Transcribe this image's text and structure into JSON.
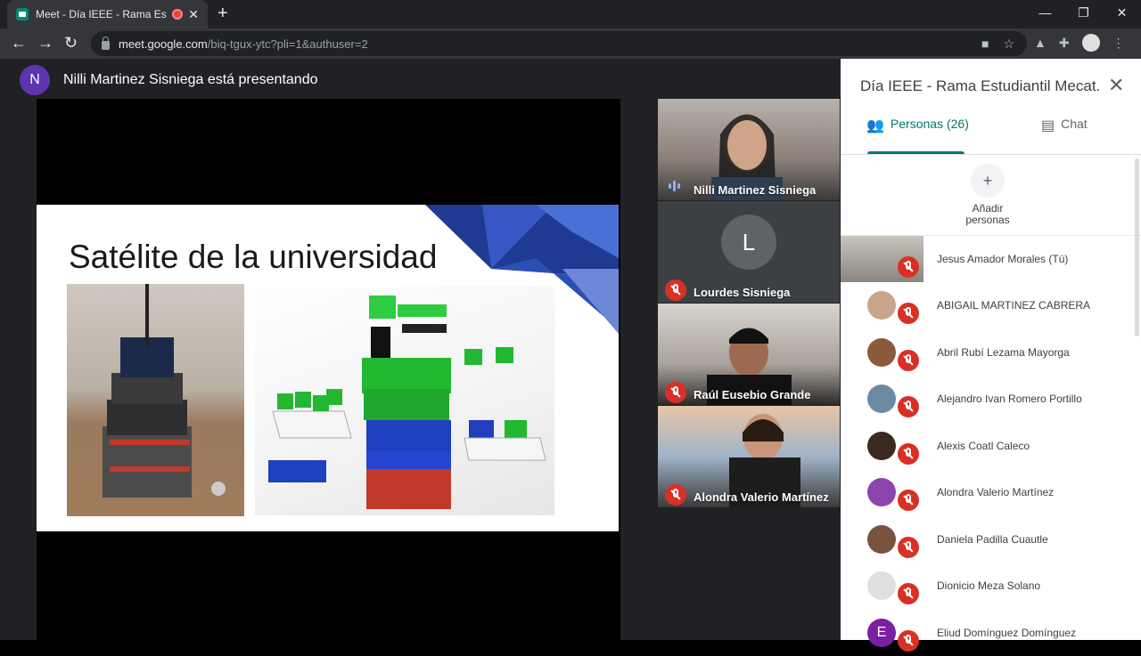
{
  "browser": {
    "tab_title": "Meet - Día IEEE - Rama Estud",
    "url_domain": "meet.google.com",
    "url_path": "/biq-tgux-ytc?pli=1&authuser=2"
  },
  "meet": {
    "presenter_initial": "N",
    "presenting_text": "Nilli Martinez Sisniega está presentando",
    "slide": {
      "title": "Satélite de la universidad"
    }
  },
  "tiles": [
    {
      "name": "Nilli Martinez Sisniega",
      "status": "speaking"
    },
    {
      "name": "Lourdes Sisniega",
      "initial": "L",
      "status": "muted"
    },
    {
      "name": "Raúl Eusebio Grande",
      "status": "muted"
    },
    {
      "name": "Alondra Valerio Martínez",
      "status": "muted"
    }
  ],
  "panel": {
    "title": "Día IEEE - Rama Estudiantil Mecat...",
    "tab_people": "Personas (26)",
    "tab_chat": "Chat",
    "add_people": "Añadir personas",
    "participants": [
      {
        "name": "Jesus Amador Morales (Tú)"
      },
      {
        "name": "ABIGAIL MARTINEZ CABRERA"
      },
      {
        "name": "Abril Rubí Lezama Mayorga"
      },
      {
        "name": "Alejandro Ivan Romero Portillo"
      },
      {
        "name": "Alexis Coatl Caleco"
      },
      {
        "name": "Alondra Valerio Martínez"
      },
      {
        "name": "Daniela Padilla Cuautle"
      },
      {
        "name": "Dionicio Meza Solano"
      },
      {
        "name": "Eliud Domínguez Domínguez",
        "initial": "E"
      }
    ]
  },
  "colors": {
    "accent": "#00796b",
    "mic_off": "#d93025",
    "presenter_avatar": "#5e35b1",
    "meet_bg": "#202124"
  }
}
